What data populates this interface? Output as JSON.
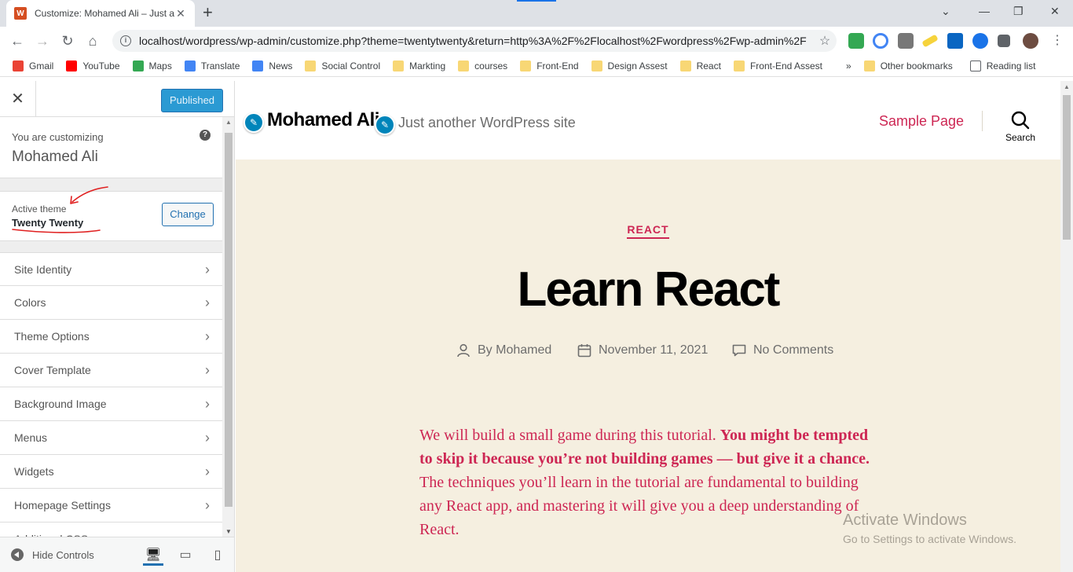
{
  "browser": {
    "tab_title": "Customize: Mohamed Ali – Just a",
    "tab_close": "✕",
    "new_tab": "+",
    "url": "localhost/wordpress/wp-admin/customize.php?theme=twentytwenty&return=http%3A%2F%2Flocalhost%2Fwordpress%2Fwp-admin%2F",
    "bookmarks": [
      {
        "label": "Gmail",
        "color": "#ea4335",
        "folder": false
      },
      {
        "label": "YouTube",
        "color": "#ff0000",
        "folder": false
      },
      {
        "label": "Maps",
        "color": "#34a853",
        "folder": false
      },
      {
        "label": "Translate",
        "color": "#4285f4",
        "folder": false
      },
      {
        "label": "News",
        "color": "#4285f4",
        "folder": false
      },
      {
        "label": "Social Control",
        "color": "#f8d775",
        "folder": true
      },
      {
        "label": "Markting",
        "color": "#f8d775",
        "folder": true
      },
      {
        "label": "courses",
        "color": "#f8d775",
        "folder": true
      },
      {
        "label": "Front-End",
        "color": "#f8d775",
        "folder": true
      },
      {
        "label": "Design Assest",
        "color": "#f8d775",
        "folder": true
      },
      {
        "label": "React",
        "color": "#f8d775",
        "folder": true
      },
      {
        "label": "Front-End Assest",
        "color": "#f8d775",
        "folder": true
      }
    ],
    "overflow": "»",
    "other_bookmarks": "Other bookmarks",
    "reading_list": "Reading list"
  },
  "customizer": {
    "published_label": "Published",
    "customizing_label": "You are customizing",
    "site_name": "Mohamed Ali",
    "help_label": "?",
    "active_theme_label": "Active theme",
    "theme_name": "Twenty Twenty",
    "change_label": "Change",
    "panels": [
      "Site Identity",
      "Colors",
      "Theme Options",
      "Cover Template",
      "Background Image",
      "Menus",
      "Widgets",
      "Homepage Settings",
      "Additional CSS"
    ],
    "hide_controls_label": "Hide Controls"
  },
  "preview": {
    "site_title": "Mohamed Ali",
    "site_description": "Just another WordPress site",
    "nav_item": "Sample Page",
    "search_label": "Search",
    "category": "REACT",
    "post_title": "Learn React",
    "author": "By Mohamed",
    "date": "November 11, 2021",
    "comments": "No Comments",
    "body_intro": "We will build a small game during this tutorial. ",
    "body_bold": "You might be tempted to skip it because you’re not building games — but give it a chance.",
    "body_rest": " The techniques you’ll learn in the tutorial are fundamental to building any React app, and mastering it will give you a deep understanding of React.",
    "accent_color": "#cd2653",
    "background_color": "#f5efe0"
  },
  "watermark": {
    "line1": "Activate Windows",
    "line2": "Go to Settings to activate Windows."
  }
}
